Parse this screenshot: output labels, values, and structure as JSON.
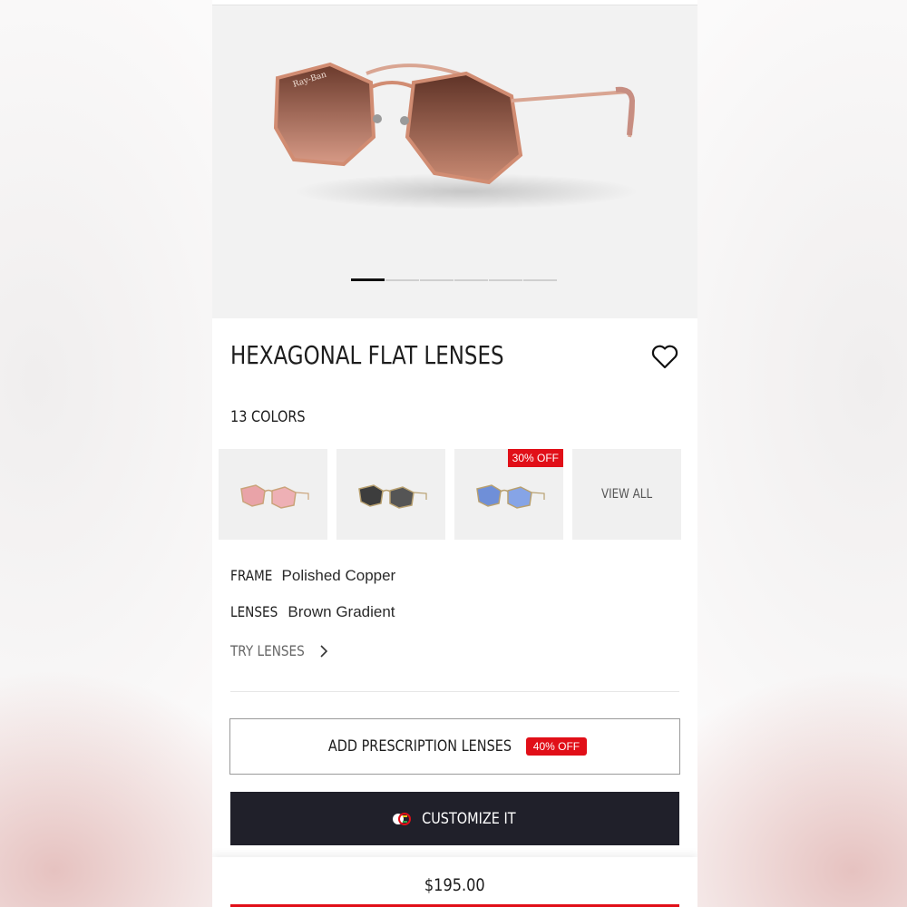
{
  "product": {
    "title": "HEXAGONAL FLAT LENSES",
    "colors_label": "13 COLORS",
    "carousel": {
      "slide_count": 6,
      "active_index": 0
    }
  },
  "swatches": [
    {
      "name": "pink-lens-variant",
      "badge": ""
    },
    {
      "name": "grey-lens-variant",
      "badge": ""
    },
    {
      "name": "blue-lens-variant",
      "badge": "30% OFF"
    },
    {
      "name": "view-all",
      "label": "VIEW ALL"
    }
  ],
  "specs": {
    "frame_key": "FRAME",
    "frame_value": "Polished Copper",
    "lenses_key": "LENSES",
    "lenses_value": "Brown Gradient"
  },
  "actions": {
    "try_lenses": "TRY LENSES",
    "add_rx": "ADD PRESCRIPTION LENSES",
    "add_rx_badge": "40% OFF",
    "customize": "CUSTOMIZE IT"
  },
  "footer": {
    "price": "$195.00"
  },
  "colors": {
    "accent_red": "#e10f18",
    "dark_button": "#20202a"
  }
}
